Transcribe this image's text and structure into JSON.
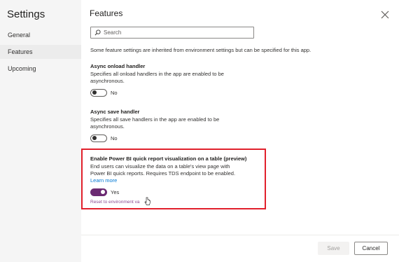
{
  "sidebar": {
    "title": "Settings",
    "items": [
      {
        "label": "General"
      },
      {
        "label": "Features"
      },
      {
        "label": "Upcoming"
      }
    ]
  },
  "main": {
    "title": "Features",
    "search": {
      "placeholder": "Search",
      "value": ""
    },
    "info_text": "Some feature settings are inherited from environment settings but can be specified for this app.",
    "settings": [
      {
        "title": "Async onload handler",
        "description": "Specifies all onload handlers in the app are enabled to be asynchronous.",
        "toggle_state": "off",
        "toggle_label": "No"
      },
      {
        "title": "Async save handler",
        "description": "Specifies all save handlers in the app are enabled to be asynchronous.",
        "toggle_state": "off",
        "toggle_label": "No"
      },
      {
        "title": "Enable Power BI quick report visualization on a table (preview)",
        "description": "End users can visualize the data on a table's view page with Power BI quick reports. Requires TDS endpoint to be enabled.",
        "learn_more": "Learn more",
        "toggle_state": "on",
        "toggle_label": "Yes",
        "reset_label": "Reset to environment va"
      }
    ]
  },
  "footer": {
    "save_label": "Save",
    "cancel_label": "Cancel"
  },
  "colors": {
    "accent": "#6b2a72",
    "highlight_border": "#e1202c",
    "link": "#0078d4"
  },
  "icons": {
    "close": "close-icon",
    "search": "search-icon",
    "cursor": "pointer-hand-icon"
  }
}
